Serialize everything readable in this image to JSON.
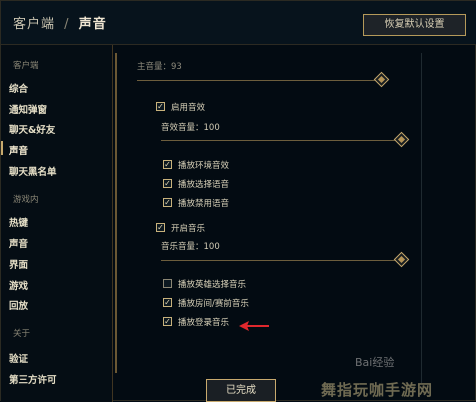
{
  "header": {
    "crumb_root": "客户端",
    "crumb_sep": "/",
    "crumb_current": "声音",
    "restore_label": "恢复默认设置"
  },
  "sidebar": {
    "client_heading": "客户端",
    "client_items": [
      "综合",
      "通知弹窗",
      "聊天&好友",
      "声音",
      "聊天黑名单"
    ],
    "ingame_heading": "游戏内",
    "ingame_items": [
      "热键",
      "声音",
      "界面",
      "游戏",
      "回放"
    ],
    "about_heading": "关于",
    "about_items": [
      "验证",
      "第三方许可"
    ]
  },
  "content": {
    "master_volume_label": "主音量：93",
    "master_volume": 93,
    "enable_sfx": {
      "label": "启用音效",
      "checked": true
    },
    "sfx_volume_label": "音效音量：100",
    "sfx_volume": 100,
    "sfx_options": [
      {
        "label": "播放环境音效",
        "checked": true
      },
      {
        "label": "播放选择语音",
        "checked": true
      },
      {
        "label": "播放禁用语音",
        "checked": true
      }
    ],
    "enable_music": {
      "label": "开启音乐",
      "checked": true
    },
    "music_volume_label": "音乐音量：100",
    "music_volume": 100,
    "music_options": [
      {
        "label": "播放英雄选择音乐",
        "checked": false
      },
      {
        "label": "播放房间/赛前音乐",
        "checked": true
      },
      {
        "label": "播放登录音乐",
        "checked": true
      }
    ]
  },
  "footer": {
    "done_label": "已完成"
  },
  "watermark": {
    "text": "舞指玩咖手游网",
    "badge": "Bai经验"
  },
  "colors": {
    "accent_gold": "#c8aa6e",
    "background": "#010a13",
    "arrow_red": "#e0282d"
  }
}
